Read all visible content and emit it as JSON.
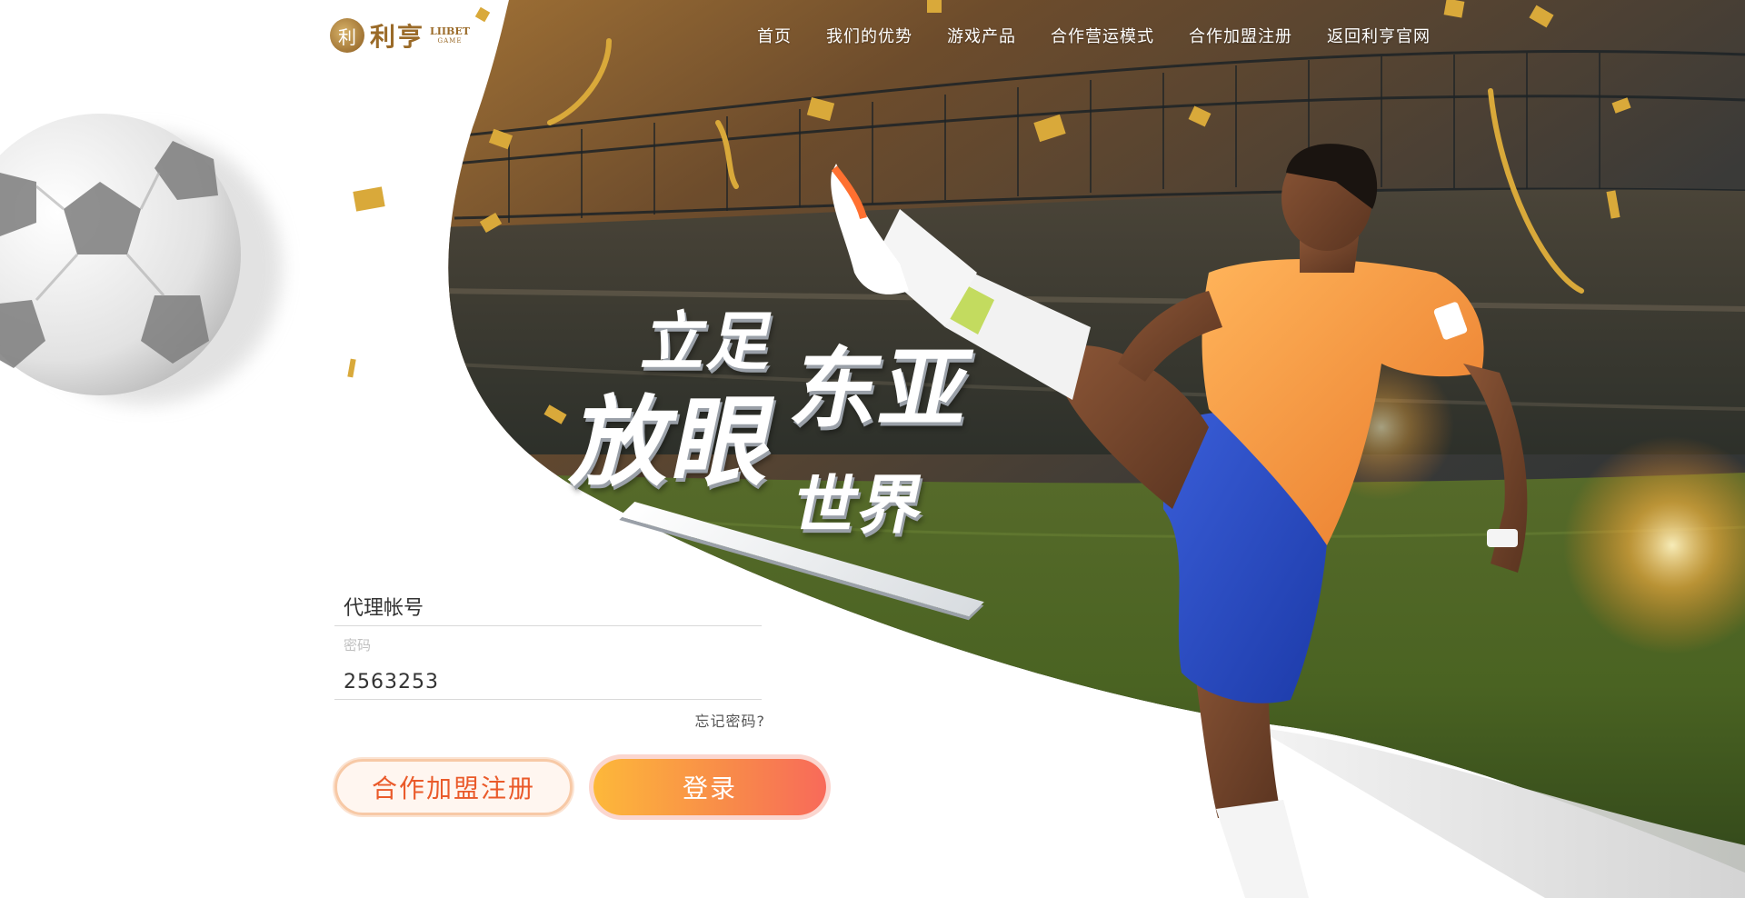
{
  "brand": {
    "mark": "利",
    "name_cn": "利亨",
    "name_en": "LIIBET",
    "tagline": "GAME"
  },
  "nav": [
    {
      "label": "首页"
    },
    {
      "label": "我们的优势"
    },
    {
      "label": "游戏产品"
    },
    {
      "label": "合作营运模式"
    },
    {
      "label": "合作加盟注册"
    },
    {
      "label": "返回利亨官网"
    }
  ],
  "slogan": {
    "line1": "立足",
    "line2": "东亚",
    "line3": "放眼",
    "line4": "世界"
  },
  "login": {
    "account_placeholder": "代理帐号",
    "password_label": "密码",
    "password_value": "2563253",
    "forgot_label": "忘记密码?",
    "register_label": "合作加盟注册",
    "login_label": "登录"
  },
  "colors": {
    "accent_orange": "#f8894a",
    "accent_gold": "#fdb83a",
    "brand_gold": "#9a6a28",
    "register_text": "#ea5a2a"
  }
}
